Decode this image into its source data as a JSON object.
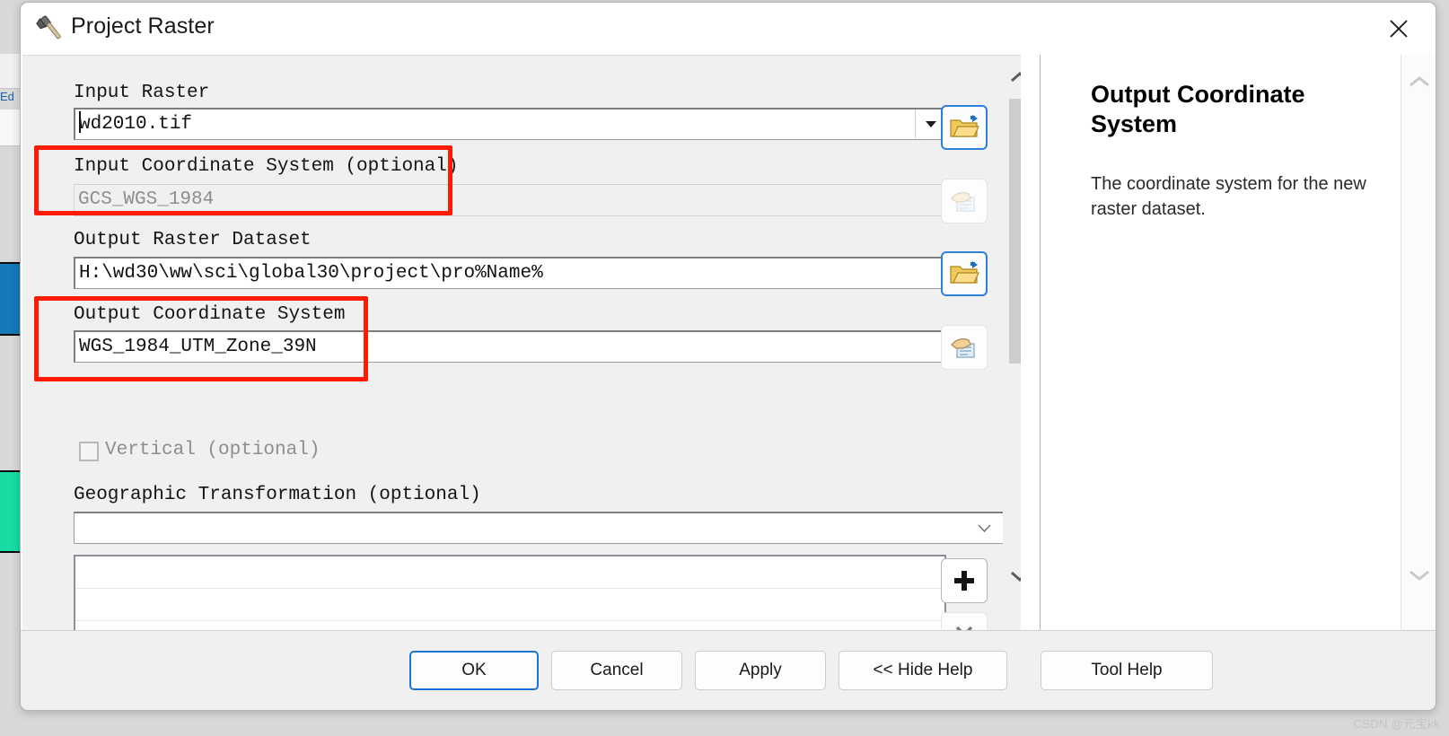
{
  "window": {
    "title": "Project Raster",
    "icon": "hammer-tool-icon",
    "close_label": "✕"
  },
  "background": {
    "fragment_text": "Ed"
  },
  "form": {
    "input_raster": {
      "label": "Input Raster",
      "value": "wd2010.tif",
      "browse_icon": "open-folder-icon",
      "dropdown_icon": "dropdown-arrow-icon"
    },
    "input_coordinate_system": {
      "label": "Input Coordinate System (optional)",
      "value": "GCS_WGS_1984",
      "picker_icon": "select-coordinate-system-icon",
      "disabled": "true"
    },
    "output_raster_dataset": {
      "label": "Output Raster Dataset",
      "value": "H:\\wd30\\ww\\sci\\global30\\project\\pro%Name%",
      "browse_icon": "open-folder-icon"
    },
    "output_coordinate_system": {
      "label": "Output Coordinate System",
      "value": "WGS_1984_UTM_Zone_39N",
      "picker_icon": "select-coordinate-system-icon"
    },
    "vertical": {
      "label": "Vertical (optional)",
      "checked": "false"
    },
    "geographic_transformation": {
      "label": "Geographic Transformation (optional)",
      "value": "",
      "dropdown_icon": "chevron-down-icon",
      "add_icon": "plus-icon",
      "remove_icon": "cross-icon",
      "rows": [
        "",
        "",
        "",
        ""
      ]
    }
  },
  "help": {
    "title": "Output Coordinate System",
    "body": "The coordinate system for the new raster dataset.",
    "scroll_up_icon": "chevron-up-icon",
    "scroll_down_icon": "chevron-down-icon"
  },
  "scrollbar": {
    "up_icon": "chevron-up-icon",
    "down_icon": "chevron-down-icon"
  },
  "footer": {
    "ok": "OK",
    "cancel": "Cancel",
    "apply": "Apply",
    "hide_help": "<< Hide Help",
    "tool_help": "Tool Help"
  },
  "watermark": "CSDN @元宝kk",
  "colors": {
    "annotation_red": "#ff1a00",
    "focus_blue": "#1a74d4",
    "dialog_bg": "#f0f0f0",
    "help_bg": "#ffffff"
  }
}
